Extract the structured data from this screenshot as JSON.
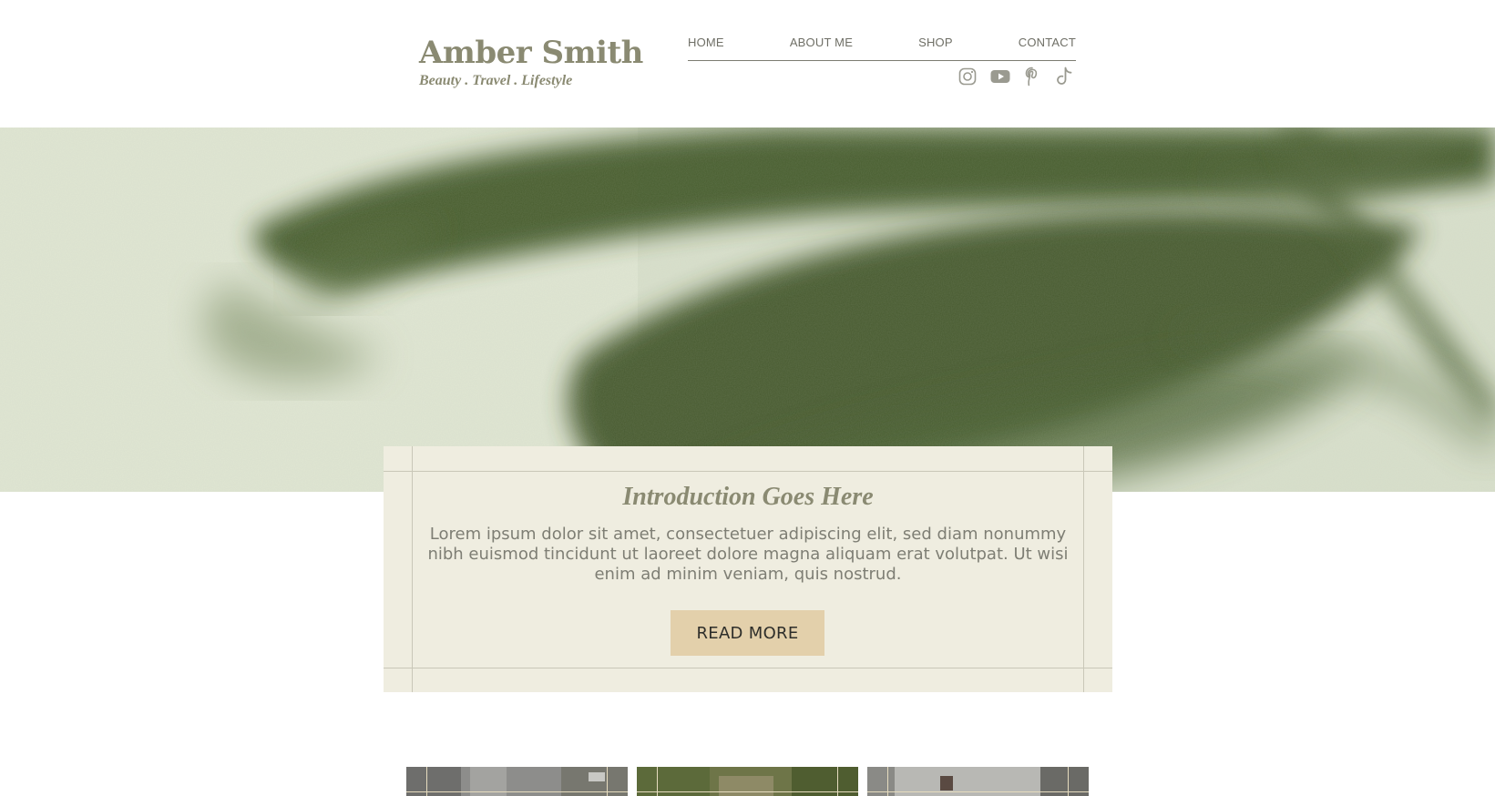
{
  "brand": {
    "name": "Amber Smith",
    "tagline": "Beauty . Travel . Lifestyle"
  },
  "nav": {
    "items": [
      "HOME",
      "ABOUT ME",
      "SHOP",
      "CONTACT"
    ]
  },
  "social": {
    "icons": [
      "instagram-icon",
      "youtube-icon",
      "pinterest-icon",
      "tiktok-icon"
    ]
  },
  "intro": {
    "title": "Introduction Goes Here",
    "body": "Lorem ipsum dolor sit amet, consectetuer adipiscing elit, sed diam nonummy nibh euismod tincidunt ut laoreet dolore magna aliquam erat volutpat. Ut wisi enim ad minim veniam, quis nostrud.",
    "button_label": "READ MORE"
  },
  "colors": {
    "brand_text": "#8a8a72",
    "nav_text": "#6f6f66",
    "card_background": "#efede0",
    "button_background": "#e3d0ab",
    "hero_leaf_shadow": "#3f5626"
  }
}
